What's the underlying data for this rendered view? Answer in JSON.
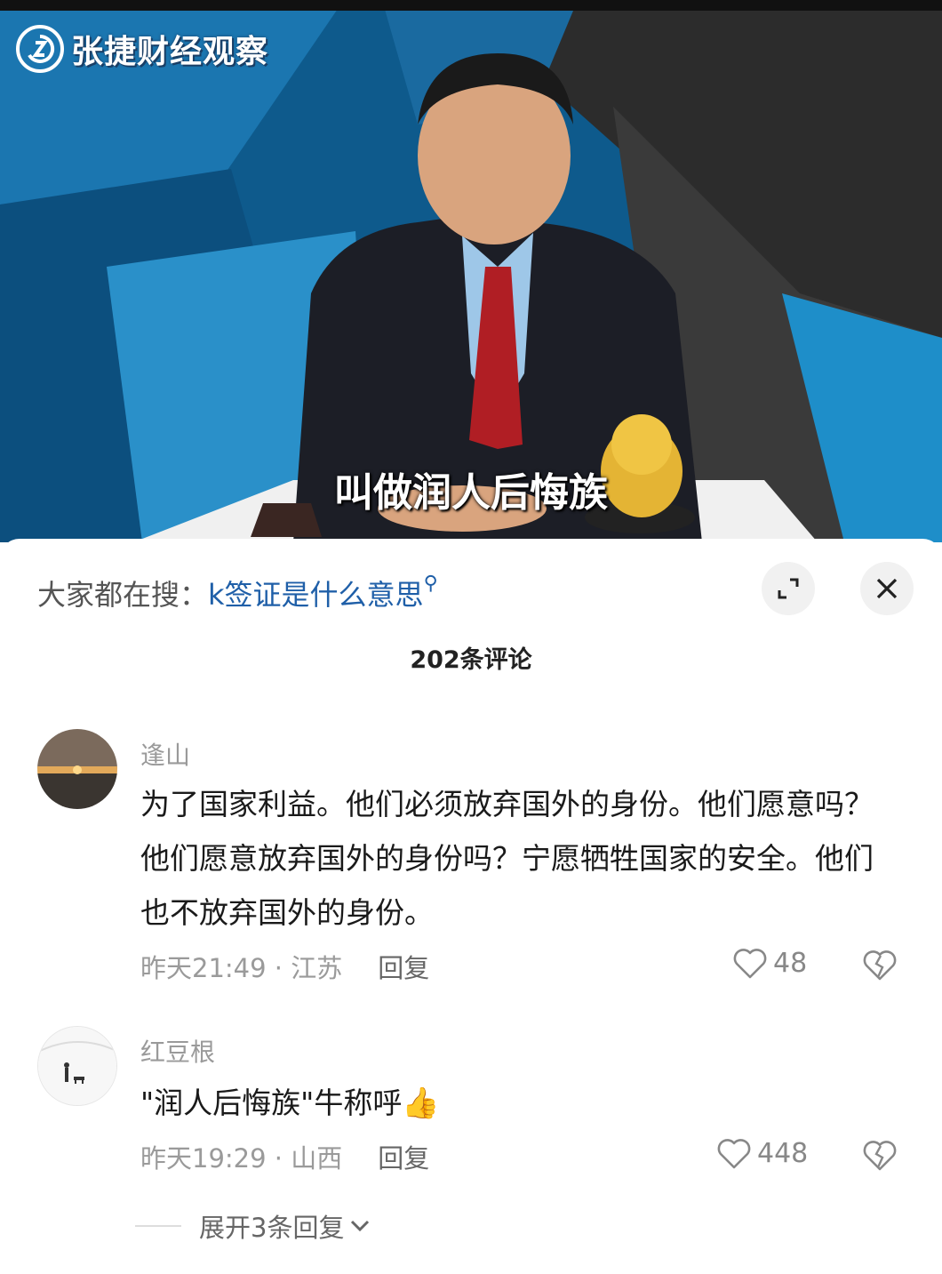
{
  "video": {
    "channel_name": "张捷财经观察",
    "subtitle": "叫做润人后悔族"
  },
  "search": {
    "prefix": "大家都在搜：",
    "query": "k签证是什么意思"
  },
  "comments_header": {
    "count_label": "202条评论"
  },
  "comments": [
    {
      "username": "逢山",
      "text": "为了国家利益。他们必须放弃国外的身份。他们愿意吗？他们愿意放弃国外的身份吗？宁愿牺牲国家的安全。他们也不放弃国外的身份。",
      "time_location": "昨天21:49 · 江苏",
      "reply_label": "回复",
      "likes": "48"
    },
    {
      "username": "红豆根",
      "text": "\"润人后悔族\"牛称呼",
      "emoji": "👍",
      "time_location": "昨天19:29 · 山西",
      "reply_label": "回复",
      "likes": "448",
      "expand_label": "展开3条回复"
    }
  ],
  "colors": {
    "link_blue": "#1f5fa8",
    "meta_gray": "#9a9a9a",
    "video_blue": "#0f5f93"
  },
  "icons": [
    "logo-icon",
    "search-icon",
    "expand-icon",
    "close-icon",
    "heart-icon",
    "heart-broken-icon",
    "chevron-down-icon"
  ]
}
